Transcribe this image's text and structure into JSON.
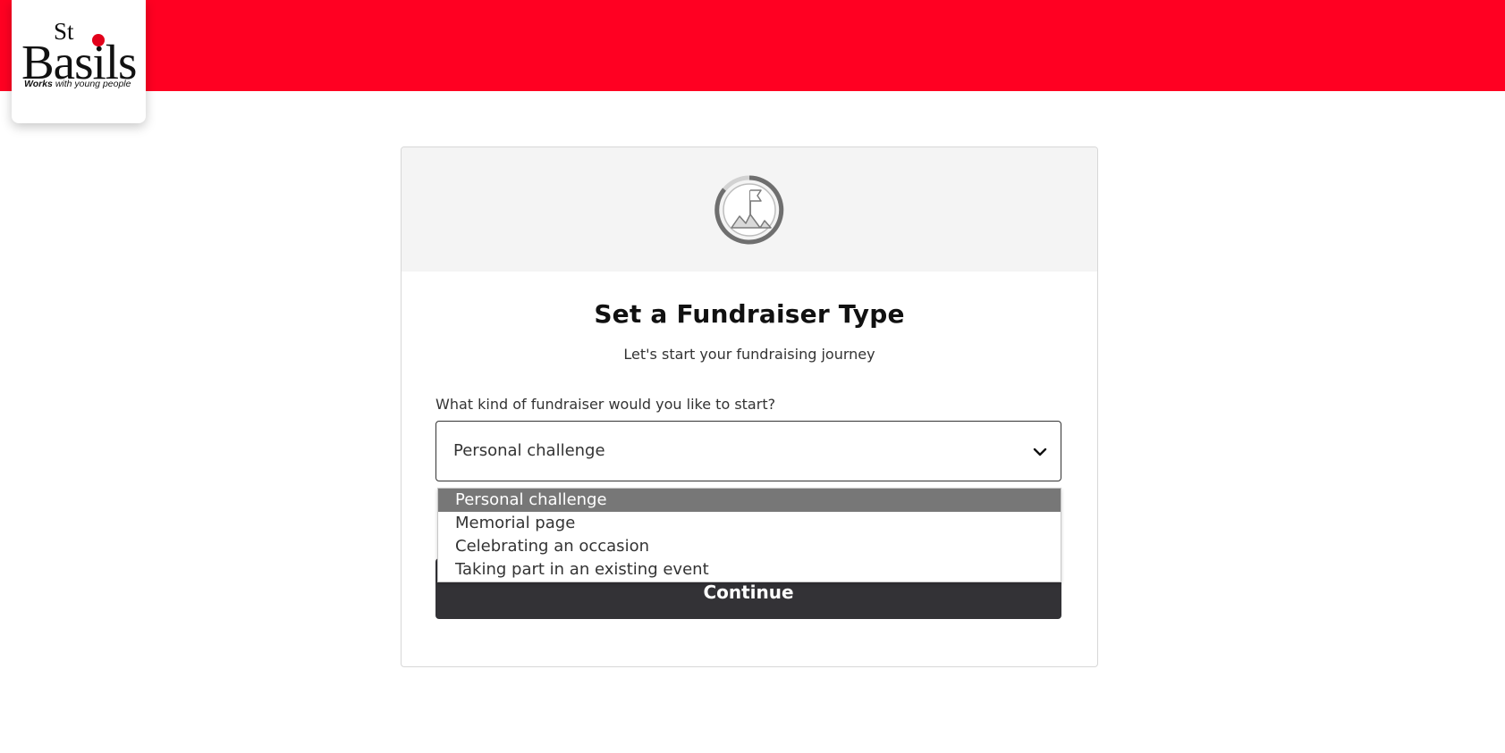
{
  "brand": {
    "logo_st": "St",
    "logo_name": "Basils",
    "tagline_bold": "Works",
    "tagline_rest": " with young people",
    "header_color": "#ff0022",
    "accent_dot_color": "#e2001a"
  },
  "card": {
    "hero_icon": "mountain-flag-progress-icon",
    "title": "Set a Fundraiser Type",
    "subtitle": "Let's start your fundraising journey"
  },
  "form": {
    "question_label": "What kind of fundraiser would you like to start?",
    "selected_value": "Personal challenge",
    "options": [
      {
        "label": "Personal challenge",
        "highlighted": true
      },
      {
        "label": "Memorial page",
        "highlighted": false
      },
      {
        "label": "Celebrating an occasion",
        "highlighted": false
      },
      {
        "label": "Taking part in an existing event",
        "highlighted": false
      }
    ],
    "continue_label": "Continue"
  }
}
